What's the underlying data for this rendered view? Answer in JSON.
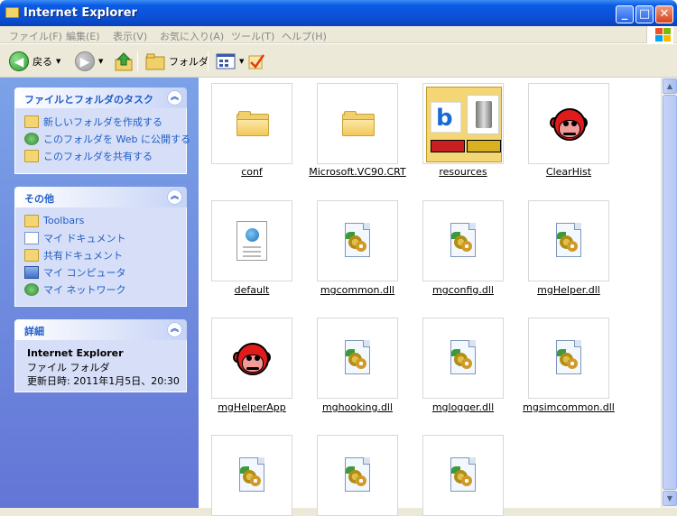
{
  "window": {
    "title": "Internet Explorer",
    "controls": {
      "minimize": "_",
      "maximize": "□",
      "close": "✕"
    }
  },
  "menubar": {
    "items": [
      "ファイル(F)",
      "編集(E)",
      "表示(V)",
      "お気に入り(A)",
      "ツール(T)",
      "ヘルプ(H)"
    ]
  },
  "toolbar": {
    "back_label": "戻る",
    "folders_label": "フォルダ",
    "back_icon": "arrow-left-icon",
    "forward_icon": "arrow-right-icon",
    "up_icon": "folder-up-icon",
    "views_icon": "views-icon"
  },
  "left_pane": {
    "tasks_panel": {
      "title": "ファイルとフォルダのタスク",
      "items": [
        {
          "label": "新しいフォルダを作成する",
          "icon": "new-folder-icon"
        },
        {
          "label": "このフォルダを Web に公開する",
          "icon": "publish-web-icon"
        },
        {
          "label": "このフォルダを共有する",
          "icon": "share-folder-icon"
        }
      ]
    },
    "other_panel": {
      "title": "その他",
      "items": [
        {
          "label": "Toolbars",
          "icon": "folder-icon"
        },
        {
          "label": "マイ ドキュメント",
          "icon": "my-documents-icon"
        },
        {
          "label": "共有ドキュメント",
          "icon": "shared-documents-icon"
        },
        {
          "label": "マイ コンピュータ",
          "icon": "my-computer-icon"
        },
        {
          "label": "マイ ネットワーク",
          "icon": "my-network-icon"
        }
      ]
    },
    "details_panel": {
      "title": "詳細",
      "name": "Internet Explorer",
      "type": "ファイル フォルダ",
      "modified": "更新日時: 2011年1月5日、20:30"
    }
  },
  "files": [
    {
      "name": "conf",
      "icon": "folder-icon"
    },
    {
      "name": "Microsoft.VC90.CRT",
      "icon": "folder-icon"
    },
    {
      "name": "resources",
      "icon": "folder-thumbnail-icon"
    },
    {
      "name": "ClearHist",
      "icon": "monkey-app-icon"
    },
    {
      "name": "default",
      "icon": "html-document-icon"
    },
    {
      "name": "mgcommon.dll",
      "icon": "dll-icon"
    },
    {
      "name": "mgconfig.dll",
      "icon": "dll-icon"
    },
    {
      "name": "mgHelper.dll",
      "icon": "dll-icon"
    },
    {
      "name": "mgHelperApp",
      "icon": "monkey-app-icon"
    },
    {
      "name": "mghooking.dll",
      "icon": "dll-icon"
    },
    {
      "name": "mglogger.dll",
      "icon": "dll-icon"
    },
    {
      "name": "mgsimcommon.dll",
      "icon": "dll-icon"
    },
    {
      "name": "",
      "icon": "dll-icon"
    },
    {
      "name": "",
      "icon": "dll-icon"
    },
    {
      "name": "",
      "icon": "dll-icon"
    }
  ],
  "colors": {
    "titlebar": "#0a52d8",
    "task_link": "#215dc6",
    "left_pane": "#6f8ee0"
  }
}
